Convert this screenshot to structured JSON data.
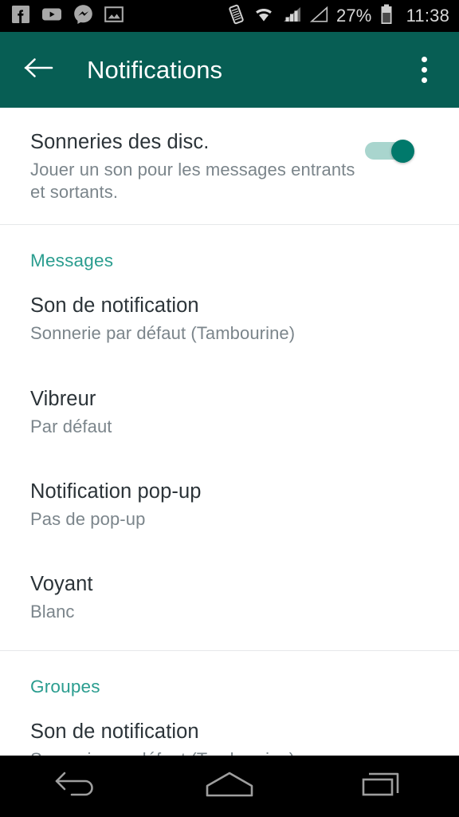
{
  "status_bar": {
    "left_icons": [
      {
        "name": "facebook-icon",
        "label": "Facebook"
      },
      {
        "name": "youtube-icon",
        "label": "YouTube"
      },
      {
        "name": "messenger-icon",
        "label": "Messenger"
      },
      {
        "name": "image-icon",
        "label": "Screenshot"
      }
    ],
    "right_icons": [
      {
        "name": "vibrate-icon",
        "label": "Vibrate"
      },
      {
        "name": "wifi-icon",
        "label": "Wi-Fi"
      },
      {
        "name": "signal-bars-icon",
        "label": "Mobile signal"
      },
      {
        "name": "signal-empty-icon",
        "label": "Second SIM no signal"
      }
    ],
    "battery_percent": "27%",
    "clock": "11:38",
    "background_color": "#000000",
    "text_color": "#d8d8d8"
  },
  "app_bar": {
    "title": "Notifications",
    "back_icon": "arrow-left-icon",
    "overflow_icon": "more-vertical-icon",
    "background_color": "#075e54",
    "text_color": "#ffffff"
  },
  "master_setting": {
    "title": "Sonneries des disc.",
    "subtitle": "Jouer un son pour les messages entrants et sortants.",
    "toggle_on": true,
    "toggle_track_color": "#a9d5ce",
    "toggle_thumb_color": "#00796b"
  },
  "sections": [
    {
      "header": "Messages",
      "header_color": "#2a9d8f",
      "items": [
        {
          "title": "Son de notification",
          "value": "Sonnerie par défaut (Tambourine)"
        },
        {
          "title": "Vibreur",
          "value": "Par défaut"
        },
        {
          "title": "Notification pop-up",
          "value": "Pas de pop-up"
        },
        {
          "title": "Voyant",
          "value": "Blanc"
        }
      ]
    },
    {
      "header": "Groupes",
      "header_color": "#2a9d8f",
      "items": [
        {
          "title": "Son de notification",
          "value": "Sonnerie par défaut (Tambourine)"
        }
      ]
    }
  ],
  "nav_bar": {
    "back_label": "Retour",
    "home_label": "Accueil",
    "recents_label": "Applications récentes",
    "background_color": "#000000",
    "icon_color": "#9e9e9e"
  }
}
